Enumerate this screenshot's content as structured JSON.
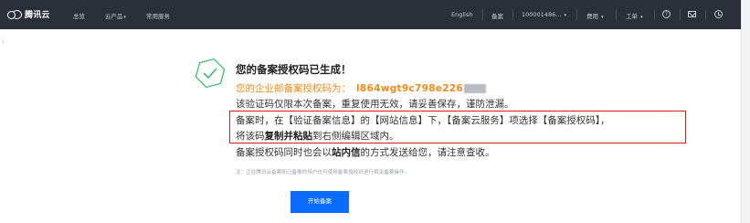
{
  "topbar": {
    "brand": "腾讯云",
    "nav_left": [
      {
        "label": "总览",
        "caret": ""
      },
      {
        "label": "云产品",
        "caret": "▾"
      },
      {
        "label": "常用服务",
        "caret": ""
      }
    ],
    "language": "English",
    "filing": "备案",
    "account": "100001486...",
    "account_caret": "▾",
    "billing": "费用",
    "billing_caret": "▾",
    "ticket": "工单",
    "ticket_caret": "▾",
    "help_glyph": "?",
    "icons": [
      "cloud-logo-icon",
      "help-icon",
      "mail-icon",
      "clock-icon"
    ]
  },
  "sidebar": {
    "collapse_glyph": "›"
  },
  "success": {
    "title": "您的备案授权码已生成！",
    "code_label": "您的企业邮备案授权码为：",
    "code_value": "l864wgt9c798e226",
    "line_single_use": "该验证码仅限本次备案，重复使用无效，请妥善保存，谨防泄漏。",
    "instruction_line1": "备案时，在【验证备案信息】的【网站信息】下，【备案云服务】项选择【备案授权码】，",
    "instruction_line2_pre": "将该码",
    "instruction_line2_bold": "复制并粘贴",
    "instruction_line2_post": "到右侧编辑区域内。",
    "message_pre": "备案授权码同时也会以",
    "message_bold": "站内信",
    "message_post": "的方式发送给您，请注意查收。",
    "note": "注：正在腾讯云备案和已备案的用户也可使用备案授权码进行相关备案操作。",
    "button_label": "开始备案"
  },
  "colors": {
    "topbar_bg": "#2b2f3a",
    "accent_orange": "#f08a18",
    "success_green": "#3bbf6b",
    "highlight_red": "#d81e1e",
    "primary_blue": "#0a6cff"
  }
}
